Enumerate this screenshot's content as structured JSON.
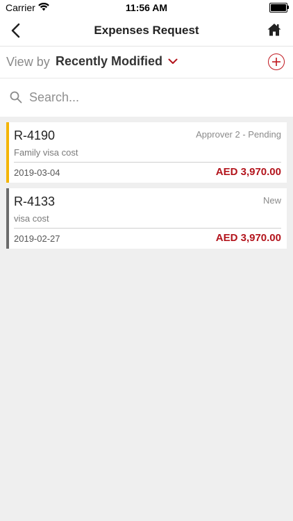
{
  "status_bar": {
    "carrier": "Carrier",
    "time": "11:56 AM"
  },
  "nav": {
    "title": "Expenses Request",
    "back_icon": "chevron-left-icon",
    "home_icon": "home-icon"
  },
  "view_by": {
    "label": "View by",
    "value": "Recently Modified",
    "add_icon": "plus-circle-icon"
  },
  "search": {
    "placeholder": "Search..."
  },
  "colors": {
    "accent": "#b3141c",
    "pending_stripe": "#f4b400",
    "new_stripe": "#6b6b6b"
  },
  "requests": [
    {
      "id": "R-4190",
      "status": "Approver 2 - Pending",
      "description": "Family visa cost",
      "date": "2019-03-04",
      "amount": "AED 3,970.00",
      "stripe_color": "#f4b400"
    },
    {
      "id": "R-4133",
      "status": "New",
      "description": "visa cost",
      "date": "2019-02-27",
      "amount": "AED 3,970.00",
      "stripe_color": "#6b6b6b"
    }
  ]
}
